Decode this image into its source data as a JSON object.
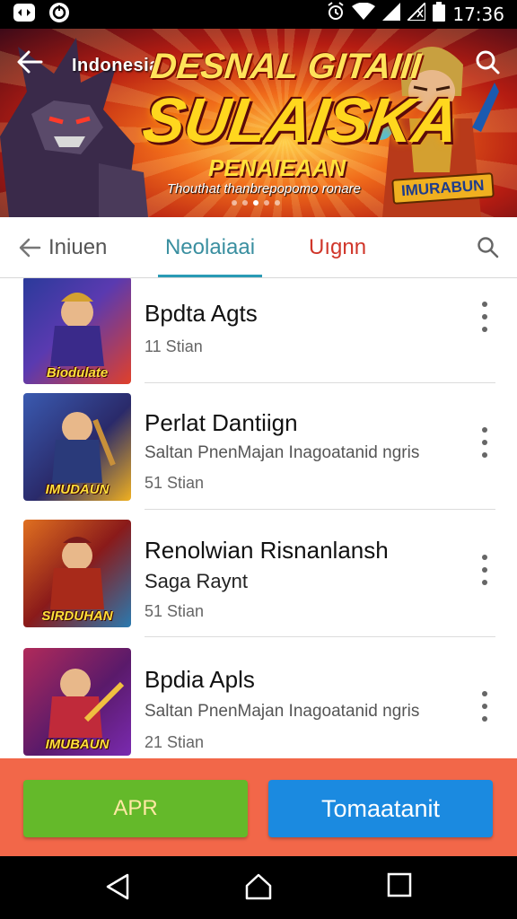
{
  "status_bar": {
    "time": "17:36",
    "icons": [
      "app-notification-icon",
      "sync-notification-icon",
      "alarm-icon",
      "wifi-icon",
      "signal-icon",
      "no-sim-icon",
      "battery-icon"
    ]
  },
  "banner": {
    "overlay_label": "Indonesia",
    "title_top": "DESNAL GITAIII",
    "title_main": "SULAISKA",
    "subtitle": "PENAIEAAN",
    "tagline": "Thouthat thanbrepopomo ronare",
    "badge": "IMURABUN",
    "pager": {
      "count": 5,
      "active": 2
    }
  },
  "tabs": {
    "back_label": "Iniuen",
    "active_label": "Neolaiaai",
    "third_label": "Uıgnn"
  },
  "list": {
    "items": [
      {
        "title": "Bpdta Agts",
        "description": "",
        "meta": "11 Stian",
        "thumb_caption": "Biodulate",
        "thumb_colors": [
          "#2a3a9a",
          "#e0402a"
        ]
      },
      {
        "title": "Perlat Dantiign",
        "description": "Saltan PnenMajan Inagoatanid ngris",
        "meta": "51 Stian",
        "thumb_caption": "IMUDAUN",
        "thumb_colors": [
          "#3a5ab0",
          "#f0b020"
        ]
      },
      {
        "title": "Renolwian Risnanlansh",
        "description": "Saga Raynt",
        "meta": "51 Stian",
        "thumb_caption": "SIRDUHAN",
        "thumb_colors": [
          "#e07020",
          "#2a7ab0"
        ]
      },
      {
        "title": "Bpdia Apls",
        "description": "Saltan PnenMajan Inagoatanid ngris",
        "meta": "21 Stian",
        "thumb_caption": "IMUBAUN",
        "thumb_colors": [
          "#b02a5a",
          "#7a2ab0"
        ]
      }
    ]
  },
  "actions": {
    "primary_label": "APR",
    "secondary_label": "Tomaatanit"
  },
  "nav": {
    "icons": [
      "back-triangle-icon",
      "home-icon",
      "recents-icon"
    ]
  },
  "colors": {
    "accent_teal": "#2a9bb5",
    "tab_red": "#d0362a",
    "action_bar": "#f26749",
    "button_green": "#64b92a",
    "button_blue": "#1b8ae0"
  }
}
